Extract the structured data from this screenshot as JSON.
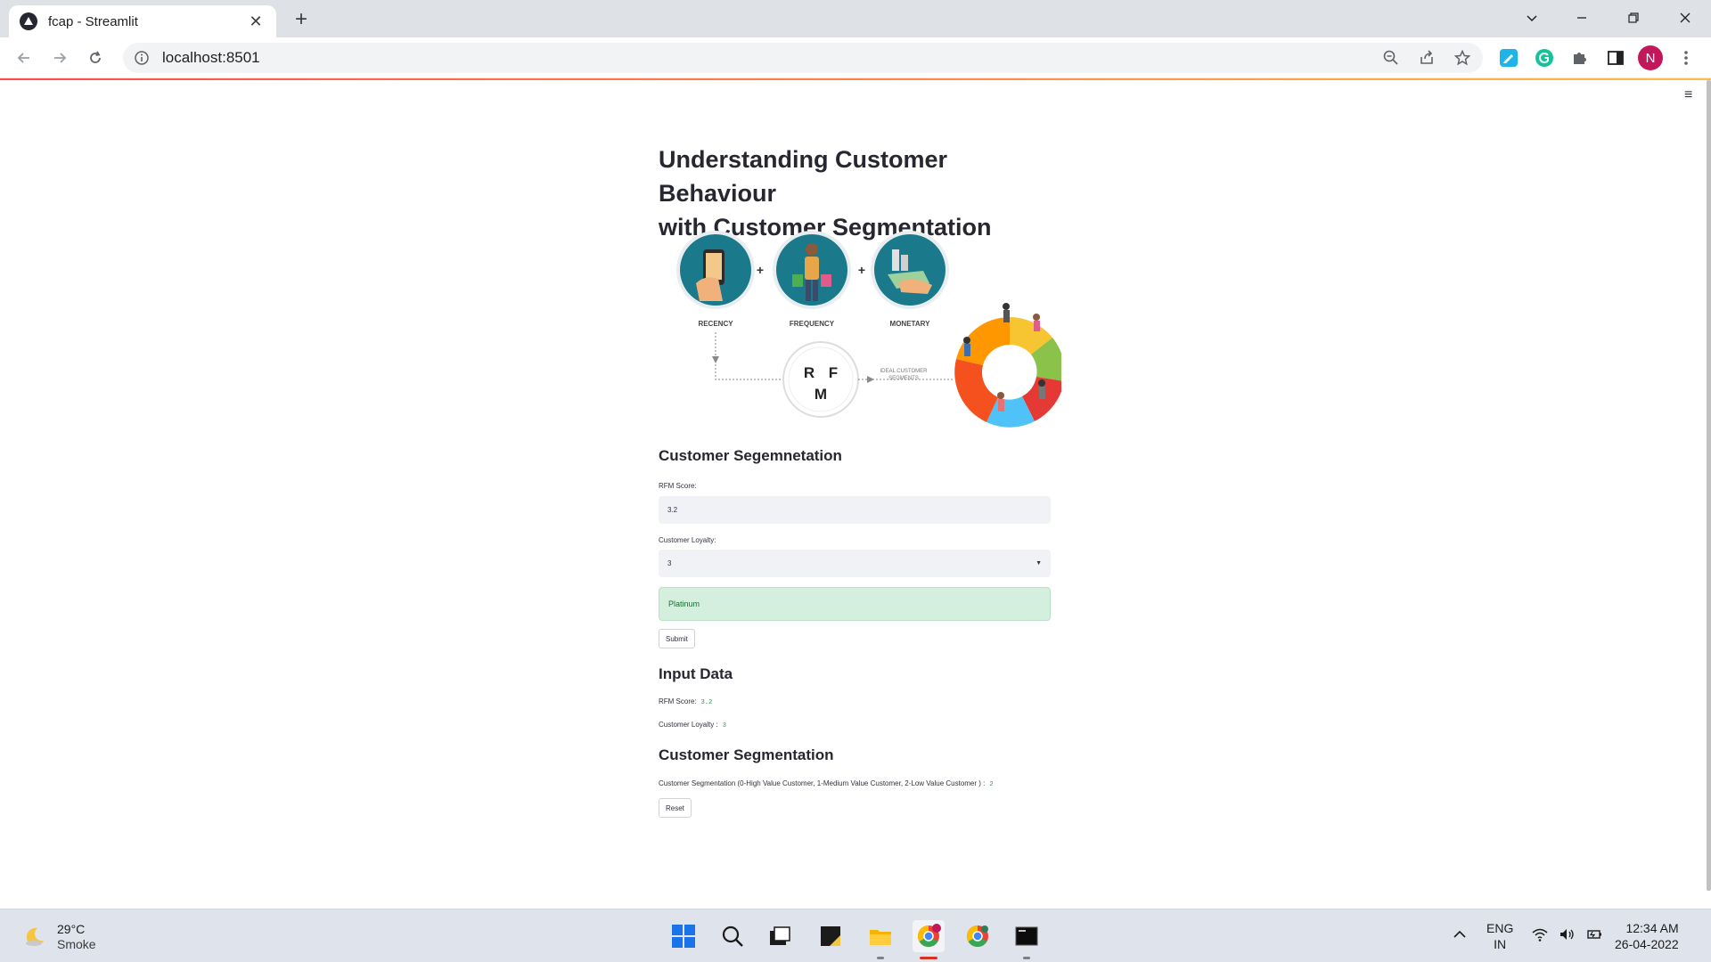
{
  "browser": {
    "tab_title": "fcap - Streamlit",
    "url": "localhost:8501",
    "profile_initial": "N",
    "accent_colors": [
      "#ff4b4b",
      "#ffbd45"
    ]
  },
  "page": {
    "title_line1": "Understanding Customer Behaviour",
    "title_line2": "with Customer Segmentation",
    "hero_labels": {
      "recency": "RECENCY",
      "frequency": "FREQUENCY",
      "monetary": "MONETARY",
      "rfm_r": "R",
      "rfm_f": "F",
      "rfm_m": "M",
      "ideal_line1": "IDEAL CUSTOMER",
      "ideal_line2": "SEGMENTS"
    },
    "form": {
      "heading": "Customer Segemnetation",
      "rfm_label": "RFM Score:",
      "rfm_value": "3.2",
      "loyalty_label": "Customer Loyalty:",
      "loyalty_value": "3",
      "result": "Platinum",
      "submit_label": "Submit"
    },
    "input_data": {
      "heading": "Input Data",
      "rfm_label": "RFM Score:",
      "rfm_value": "3.2",
      "loyalty_label": "Customer Loyalty :",
      "loyalty_value": "3"
    },
    "segmentation": {
      "heading": "Customer Segmentation",
      "text": "Customer Segmentation (0-High Value Customer, 1-Medium Value Customer, 2-Low Value Customer ) :",
      "value": "2",
      "reset_label": "Reset"
    },
    "colors": {
      "success_bg": "#d4efdd",
      "input_bg": "#f0f2f6",
      "code_green": "#09ab3b"
    }
  },
  "taskbar": {
    "weather_temp": "29°C",
    "weather_condition": "Smoke",
    "lang_line1": "ENG",
    "lang_line2": "IN",
    "time": "12:34 AM",
    "date": "26-04-2022"
  }
}
